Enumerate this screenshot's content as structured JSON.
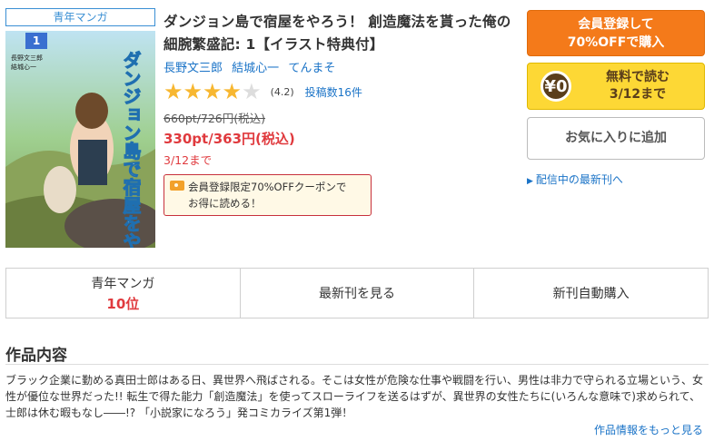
{
  "genre_tag": "青年マンガ",
  "book": {
    "title": "ダンジョン島で宿屋をやろう！ 創造魔法を貰った俺の細腕繁盛記: 1【イラスト特典付】",
    "authors": [
      "長野文三郎",
      "結城心一",
      "てんまそ"
    ],
    "rating": {
      "value": 4.2,
      "stars_filled": 4,
      "stars_total": 5,
      "score_text": "(4.2)",
      "posts_text": "投稿数16件"
    },
    "price_original": "660pt/726円(税込)",
    "price_current": "330pt/363円(税込)",
    "sale_until": "3/12まで",
    "coupon": {
      "line1": "会員登録限定70%OFFクーポンで",
      "line2": "お得に読める！"
    }
  },
  "cover": {
    "title_text": "ダンジョン島で宿屋をやろう!",
    "volume": "1",
    "author_lines": [
      "長野文三郎",
      "結城心一"
    ]
  },
  "buttons": {
    "register_line1": "会員登録して",
    "register_line2": "70%OFFで購入",
    "free_icon": "¥0",
    "free_line1": "無料で読む",
    "free_line2": "3/12まで",
    "favorite": "お気に入りに追加",
    "latest_link": "配信中の最新刊へ"
  },
  "tabs": [
    {
      "label": "青年マンガ",
      "rank": "10位"
    },
    {
      "label": "最新刊を見る"
    },
    {
      "label": "新刊自動購入"
    }
  ],
  "synopsis": {
    "heading": "作品内容",
    "text": "ブラック企業に勤める真田士郎はある日、異世界へ飛ばされる。そこは女性が危険な仕事や戦闘を行い、男性は非力で守られる立場という、女性が優位な世界だった!! 転生で得た能力「創造魔法」を使ってスローライフを送るはずが、異世界の女性たちに(いろんな意味で)求められて、士郎は休む暇もなし――!? 「小説家になろう」発コミカライズ第1弾！",
    "more_link": "作品情報をもっと見る"
  },
  "colors": {
    "accent_blue": "#1a73c7",
    "price_red": "#e03a3e",
    "register_orange": "#f47a1a",
    "free_yellow": "#fdd835",
    "star_gold": "#f7b731"
  }
}
